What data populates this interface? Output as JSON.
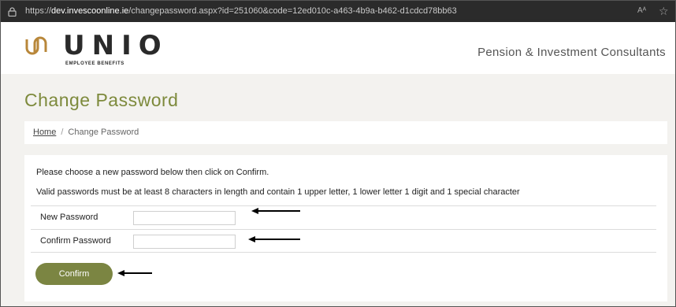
{
  "browser": {
    "url_prefix": "https://",
    "url_domain": "dev.invescoonline.ie",
    "url_path": "/changepassword.aspx?id=251060&code=12ed010c-a463-4b9a-b462-d1cdcd78bb63",
    "read_aloud_label": "Aᴬ"
  },
  "header": {
    "logo_text": "UNIO",
    "logo_subtitle": "EMPLOYEE BENEFITS",
    "tagline": "Pension & Investment Consultants"
  },
  "page": {
    "title": "Change Password",
    "breadcrumb": {
      "home": "Home",
      "separator": "/",
      "current": "Change Password"
    },
    "instructions": "Please choose a new password below then click on Confirm.",
    "rules": "Valid passwords must be at least 8 characters in length and contain 1 upper letter, 1 lower letter 1 digit and 1 special character",
    "fields": {
      "new_password_label": "New Password",
      "new_password_value": "",
      "confirm_password_label": "Confirm Password",
      "confirm_password_value": ""
    },
    "confirm_label": "Confirm"
  },
  "colors": {
    "accent_olive": "#7d8a3c",
    "button_olive": "#7b8542",
    "logo_gold": "#b8873a"
  }
}
